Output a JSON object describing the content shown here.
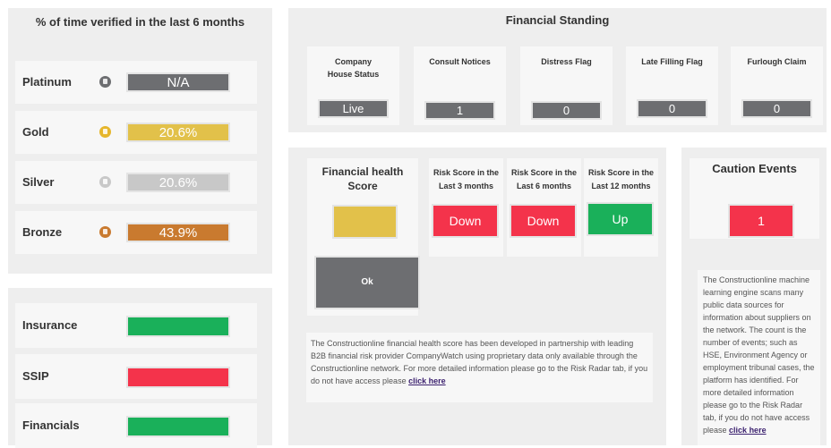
{
  "verification": {
    "title": "% of time verified in the last 6 months",
    "tiers": [
      {
        "label": "Platinum",
        "value": "N/A",
        "color": "#6d6e71",
        "icon_color": "#6d6e71",
        "icon": "medal-icon"
      },
      {
        "label": "Gold",
        "value": "20.6%",
        "color": "#e2c14a",
        "icon_color": "#e6b62b",
        "icon": "medal-icon"
      },
      {
        "label": "Silver",
        "value": "20.6%",
        "color": "#c8c8c8",
        "icon_color": "#c8c8c8",
        "icon": "medal-icon"
      },
      {
        "label": "Bronze",
        "value": "43.9%",
        "color": "#c97a2f",
        "icon_color": "#c97a2f",
        "icon": "medal-icon"
      }
    ]
  },
  "statuses": [
    {
      "label": "Insurance",
      "color": "#1ab05a"
    },
    {
      "label": "SSIP",
      "color": "#f4334b"
    },
    {
      "label": "Financials",
      "color": "#1ab05a"
    }
  ],
  "financial_standing": {
    "title": "Financial Standing",
    "items": [
      {
        "label": "Company House Status",
        "value": "Live"
      },
      {
        "label": "Consult Notices",
        "value": "1"
      },
      {
        "label": "Distress Flag",
        "value": "0"
      },
      {
        "label": "Late Filling Flag",
        "value": "0"
      },
      {
        "label": "Furlough Claim",
        "value": "0"
      }
    ]
  },
  "health": {
    "title": "Financial health Score",
    "score_color": "#e2c14a",
    "score_text": "Ok",
    "risks": [
      {
        "label": "Risk Score in the Last 3 months",
        "value": "Down",
        "color": "#f4334b"
      },
      {
        "label": "Risk Score in the Last 6 months",
        "value": "Down",
        "color": "#f4334b"
      },
      {
        "label": "Risk Score in the Last 12 months",
        "value": "Up",
        "color": "#1ab05a"
      }
    ],
    "description": "The Constructionline financial health score has been developed in partnership with leading B2B financial risk provider CompanyWatch using proprietary data only available through the Constructionline network. For more detailed information please go to the Risk Radar tab, if you do not have access please",
    "link": "click here"
  },
  "caution": {
    "title": "Caution Events",
    "value": "1",
    "color": "#f4334b",
    "description": "The Constructionline machine learning engine scans many public data sources for information about suppliers on the network. The count is the number of events; such as HSE, Environment Agency or employment tribunal cases, the platform has identified. For more detailed information please go to the Risk Radar tab, if you do not have access please",
    "link": "click here"
  }
}
